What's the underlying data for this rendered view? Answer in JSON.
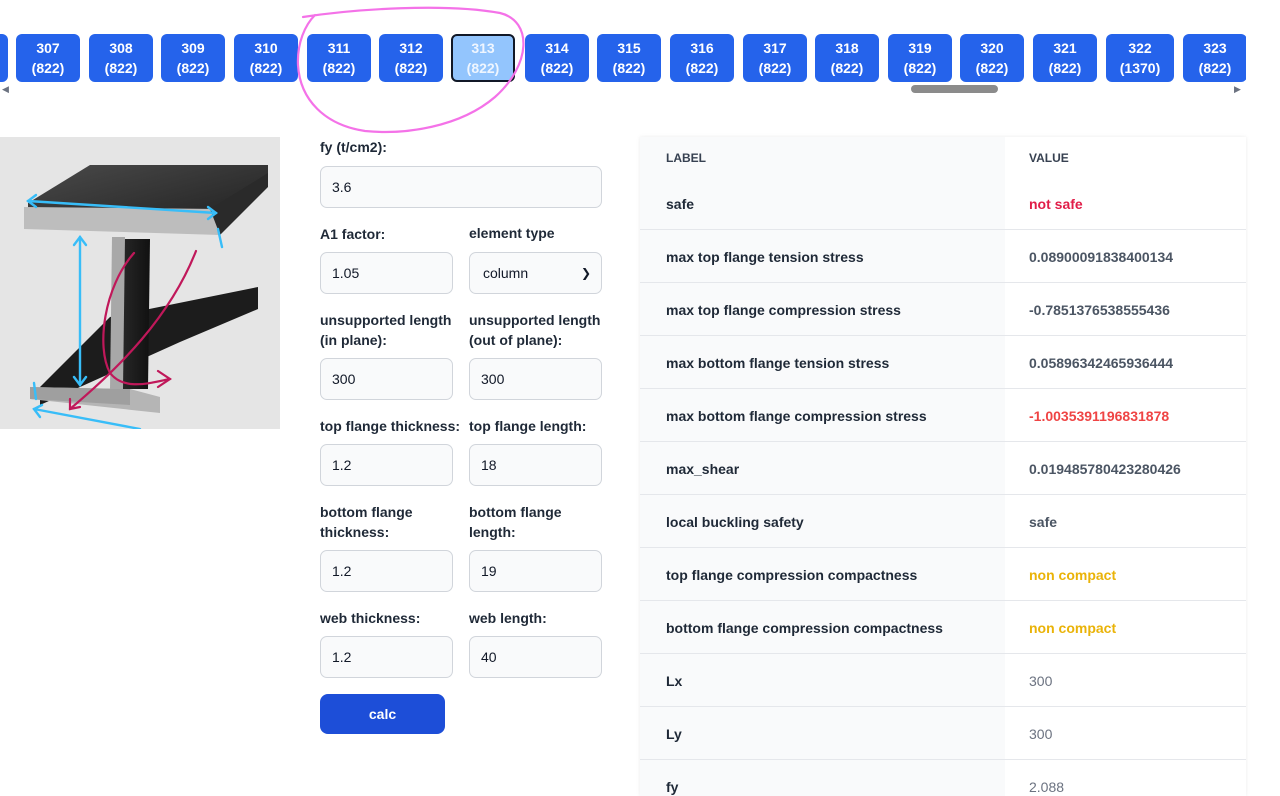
{
  "tabs": [
    {
      "num": "307",
      "count": "(822)"
    },
    {
      "num": "308",
      "count": "(822)"
    },
    {
      "num": "309",
      "count": "(822)"
    },
    {
      "num": "310",
      "count": "(822)"
    },
    {
      "num": "311",
      "count": "(822)"
    },
    {
      "num": "312",
      "count": "(822)"
    },
    {
      "num": "313",
      "count": "(822)"
    },
    {
      "num": "314",
      "count": "(822)"
    },
    {
      "num": "315",
      "count": "(822)"
    },
    {
      "num": "316",
      "count": "(822)"
    },
    {
      "num": "317",
      "count": "(822)"
    },
    {
      "num": "318",
      "count": "(822)"
    },
    {
      "num": "319",
      "count": "(822)"
    },
    {
      "num": "320",
      "count": "(822)"
    },
    {
      "num": "321",
      "count": "(822)"
    },
    {
      "num": "322",
      "count": "(1370)"
    },
    {
      "num": "323",
      "count": "(822)"
    }
  ],
  "active_tab": "313",
  "form": {
    "fy_label": "fy (t/cm2):",
    "fy_value": "3.6",
    "a1_label": "A1 factor:",
    "a1_value": "1.05",
    "element_type_label": "element type",
    "element_type_value": "column",
    "unsup_in_label": "unsupported length (in plane):",
    "unsup_in_value": "300",
    "unsup_out_label": "unsupported length (out of plane):",
    "unsup_out_value": "300",
    "top_thk_label": "top flange thickness:",
    "top_thk_value": "1.2",
    "top_len_label": "top flange length:",
    "top_len_value": "18",
    "bot_thk_label": "bottom flange thickness:",
    "bot_thk_value": "1.2",
    "bot_len_label": "bottom flange length:",
    "bot_len_value": "19",
    "web_thk_label": "web thickness:",
    "web_thk_value": "1.2",
    "web_len_label": "web length:",
    "web_len_value": "40",
    "calc_label": "calc"
  },
  "results": {
    "header_label": "LABEL",
    "header_value": "VALUE",
    "rows": [
      {
        "label": "safe",
        "value": "not safe"
      },
      {
        "label": "max top flange tension stress",
        "value": "0.08900091838400134"
      },
      {
        "label": "max top flange compression stress",
        "value": "-0.7851376538555436"
      },
      {
        "label": "max bottom flange tension stress",
        "value": "0.05896342465936444"
      },
      {
        "label": "max bottom flange compression stress",
        "value": "-1.0035391196831878"
      },
      {
        "label": "max_shear",
        "value": "0.019485780423280426"
      },
      {
        "label": "local buckling safety",
        "value": "safe"
      },
      {
        "label": "top flange compression compactness",
        "value": "non compact"
      },
      {
        "label": "bottom flange compression compactness",
        "value": "non compact"
      },
      {
        "label": "Lx",
        "value": "300"
      },
      {
        "label": "Ly",
        "value": "300"
      },
      {
        "label": "fy",
        "value": "2.088"
      }
    ]
  },
  "colors": {
    "tab_blue": "#2563eb",
    "tab_active": "#93c5fd",
    "calc_button": "#1d4ed8",
    "not_safe_red": "#e11d48",
    "negative_red": "#ef4444",
    "warning_amber": "#eab308",
    "annotation_pink": "#f472e8"
  },
  "icons": {
    "scroll_left": "left-triangle",
    "scroll_right": "right-triangle",
    "select_chevron": "chevron-down"
  }
}
